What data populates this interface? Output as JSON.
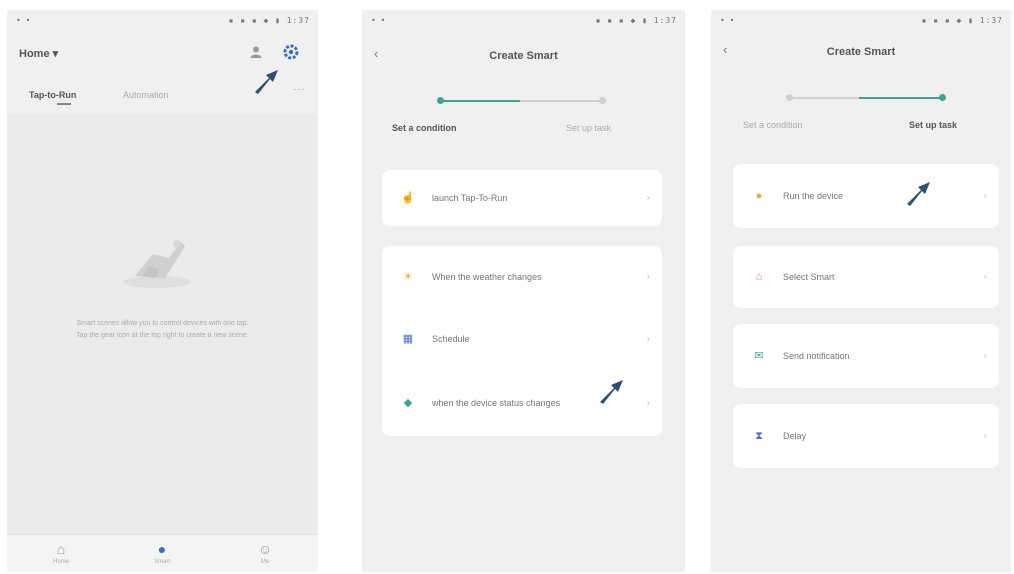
{
  "colors": {
    "accent": "#3aa78d",
    "arrow": "#2f4f6e",
    "gear": "#3b6fb6"
  },
  "screen1": {
    "status_left": "• •",
    "status_right": "▪ ▪ ▪ ◆ ▮ 1:37",
    "home_label": "Home ▾",
    "person_icon": "person-icon",
    "settings_icon": "gear-icon",
    "tabs": [
      "Tap-to-Run",
      "Automation"
    ],
    "more_label": "···",
    "empty_text_lines": [
      "Smart scenes allow you to control devices with one tap.",
      "Tap the gear icon at the top right to create a new scene."
    ],
    "nav": [
      {
        "label": "Home",
        "icon": "home-icon"
      },
      {
        "label": "Smart",
        "icon": "smart-icon"
      },
      {
        "label": "Me",
        "icon": "profile-icon"
      }
    ]
  },
  "screen2": {
    "status_left": "• •",
    "status_right": "▪ ▪ ▪ ◆ ▮ 1:37",
    "back": "‹",
    "title": "Create Smart",
    "step_active": "Set a condition",
    "step_inactive": "Set up task",
    "options": [
      {
        "label": "launch Tap-To-Run",
        "icon": "hand-tap-icon",
        "color": "#e06e6e"
      },
      {
        "label": "When the weather changes",
        "icon": "sun-icon",
        "color": "#f0a640"
      },
      {
        "label": "Schedule",
        "icon": "calendar-icon",
        "color": "#4a72c4"
      },
      {
        "label": "when the device status changes",
        "icon": "device-icon",
        "color": "#3aa78d"
      }
    ],
    "chevron": "›"
  },
  "screen3": {
    "status_left": "• •",
    "status_right": "▪ ▪ ▪ ◆ ▮ 1:37",
    "back": "‹",
    "title": "Create Smart",
    "step_inactive": "Set a condition",
    "step_active": "Set up task",
    "options": [
      {
        "label": "Run the device",
        "icon": "bulb-icon",
        "color": "#f0a640"
      },
      {
        "label": "Select Smart",
        "icon": "smart-home-icon",
        "color": "#e07a8a"
      },
      {
        "label": "Send notification",
        "icon": "notification-icon",
        "color": "#3aa78d"
      },
      {
        "label": "Delay",
        "icon": "hourglass-icon",
        "color": "#4a72c4"
      }
    ],
    "chevron": "›"
  }
}
